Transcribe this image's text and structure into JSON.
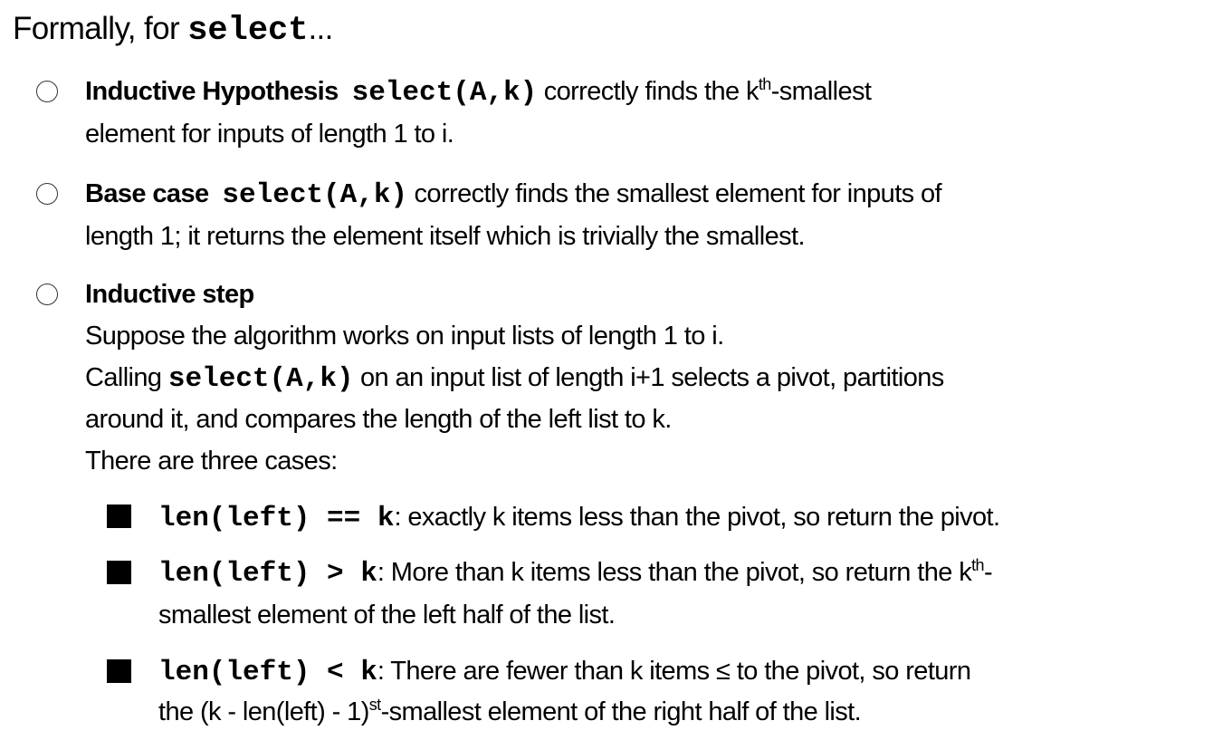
{
  "title": {
    "prefix": "Formally, for ",
    "code": "select",
    "suffix": "..."
  },
  "bullets": [
    {
      "label": "Inductive Hypothesis",
      "code": "select(A,k)",
      "line1_rest": " correctly finds the k",
      "sup": "th",
      "line1_end": "-smallest",
      "line2": "element for inputs of length 1 to i."
    },
    {
      "label": "Base case",
      "code": "select(A,k)",
      "line1_rest": " correctly finds the smallest element for inputs of",
      "line2": "length 1; it returns the element itself which is trivially the smallest."
    },
    {
      "label": "Inductive step",
      "line2": "Suppose the algorithm works on input lists of length 1 to i.",
      "line3_prefix": "Calling ",
      "line3_code": "select(A,k)",
      "line3_rest": " on an input list of length i+1 selects a pivot, partitions",
      "line4": "around it, and compares the length of the left list to k.",
      "line5": "There are three cases:"
    }
  ],
  "cases": [
    {
      "code": "len(left) == k",
      "text": ": exactly k items less than the pivot, so return the pivot."
    },
    {
      "code": "len(left) > k",
      "text": ": More than k items less than the pivot, so return the k",
      "sup": "th",
      "text_end": "-",
      "line2": "smallest element of the left half of the list."
    },
    {
      "code": "len(left) < k",
      "text": ": There are fewer than k items ≤ to the pivot, so return",
      "line2_prefix": "the (k - len(left) - 1)",
      "sup": "st",
      "line2_end": "-smallest element of the right half of the list."
    }
  ]
}
